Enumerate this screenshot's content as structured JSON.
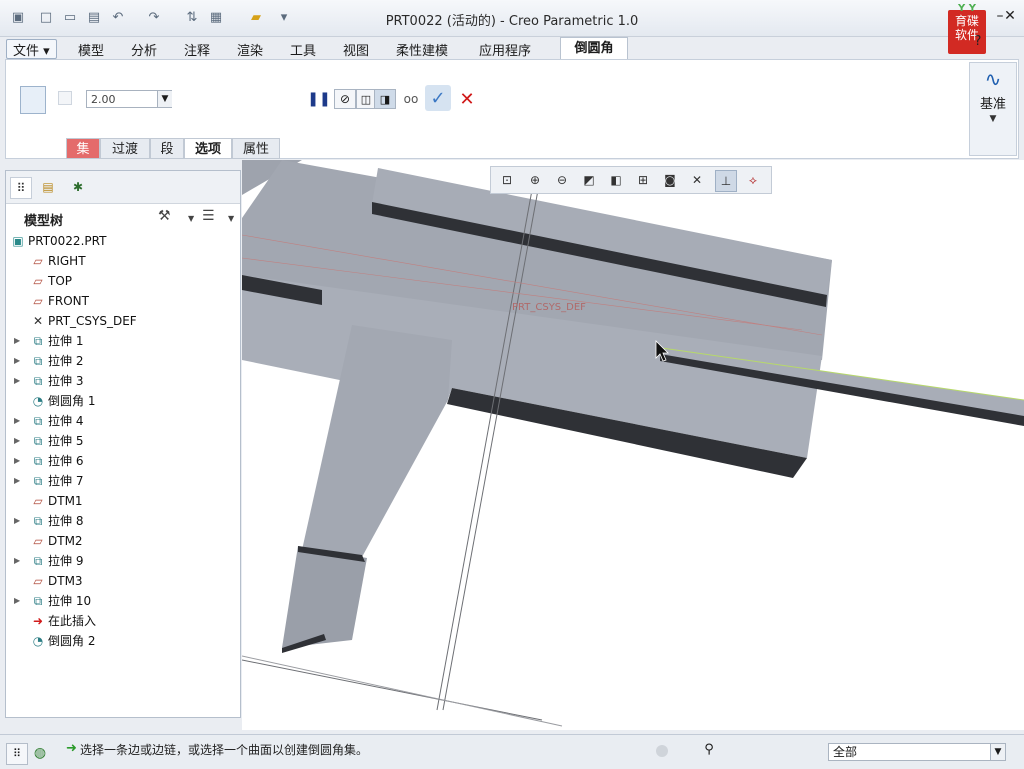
{
  "window": {
    "title": "PRT0022 (活动的) - Creo Parametric 1.0",
    "logo_text": "育碟软件"
  },
  "menu": {
    "file": "文件",
    "tabs": [
      "模型",
      "分析",
      "注释",
      "渲染",
      "工具",
      "视图",
      "柔性建模",
      "应用程序"
    ],
    "active_tab": "倒圆角"
  },
  "ribbon": {
    "radius_value": "2.00",
    "subtabs": {
      "set": "集",
      "transition": "过渡",
      "segment": "段",
      "options": "选项",
      "properties": "属性"
    },
    "datum_label": "基准"
  },
  "model_tree": {
    "title": "模型树",
    "root": "PRT0022.PRT",
    "items": [
      {
        "label": "RIGHT",
        "icon": "datum-plane-icon",
        "expandable": false
      },
      {
        "label": "TOP",
        "icon": "datum-plane-icon",
        "expandable": false
      },
      {
        "label": "FRONT",
        "icon": "datum-plane-icon",
        "expandable": false
      },
      {
        "label": "PRT_CSYS_DEF",
        "icon": "csys-icon",
        "expandable": false
      },
      {
        "label": "拉伸 1",
        "icon": "extrude-icon",
        "expandable": true
      },
      {
        "label": "拉伸 2",
        "icon": "extrude-icon",
        "expandable": true
      },
      {
        "label": "拉伸 3",
        "icon": "extrude-icon",
        "expandable": true
      },
      {
        "label": "倒圆角 1",
        "icon": "round-icon",
        "expandable": false
      },
      {
        "label": "拉伸 4",
        "icon": "extrude-icon",
        "expandable": true
      },
      {
        "label": "拉伸 5",
        "icon": "extrude-icon",
        "expandable": true
      },
      {
        "label": "拉伸 6",
        "icon": "extrude-icon",
        "expandable": true
      },
      {
        "label": "拉伸 7",
        "icon": "extrude-icon",
        "expandable": true
      },
      {
        "label": "DTM1",
        "icon": "datum-plane-icon",
        "expandable": false
      },
      {
        "label": "拉伸 8",
        "icon": "extrude-icon",
        "expandable": true
      },
      {
        "label": "DTM2",
        "icon": "datum-plane-icon",
        "expandable": false
      },
      {
        "label": "拉伸 9",
        "icon": "extrude-icon",
        "expandable": true
      },
      {
        "label": "DTM3",
        "icon": "datum-plane-icon",
        "expandable": false
      },
      {
        "label": "拉伸 10",
        "icon": "extrude-icon",
        "expandable": true
      },
      {
        "label": "在此插入",
        "icon": "insert-here-icon",
        "expandable": false
      },
      {
        "label": "倒圆角 2",
        "icon": "round-new-icon",
        "expandable": false
      }
    ]
  },
  "viewport": {
    "csys_label": "PRT_CSYS_DEF"
  },
  "status": {
    "message": "选择一条边或边链，或选择一个曲面以创建倒圆角集。",
    "filter": "全部"
  },
  "colors": {
    "part_top": "#9ea3ad",
    "part_side": "#2f3136",
    "active_subtab": "#e46b6b",
    "ok_check": "#3b78c4",
    "cancel_x": "#d01818"
  }
}
